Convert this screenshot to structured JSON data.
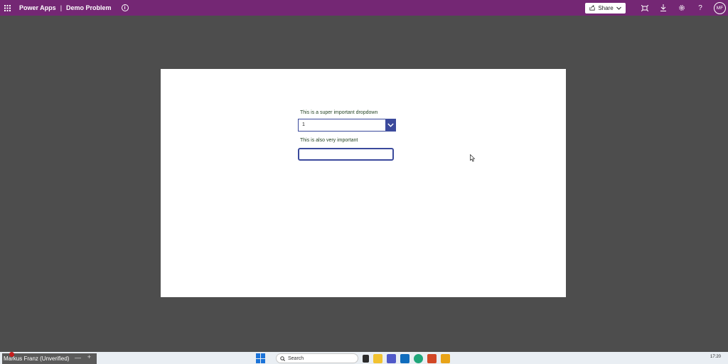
{
  "header": {
    "brand": "Power Apps",
    "separator": "|",
    "app_name": "Demo Problem",
    "share_label": "Share",
    "avatar_initials": "MF",
    "color": "#742774"
  },
  "canvas": {
    "dropdown_label": "This is a super important dropdown",
    "dropdown_value": "1",
    "textinput_label": "This is also very important",
    "textinput_value": ""
  },
  "taskbar": {
    "user_label": "Markus Franz (Unverified)",
    "search_placeholder": "Search",
    "time": "17:20"
  }
}
